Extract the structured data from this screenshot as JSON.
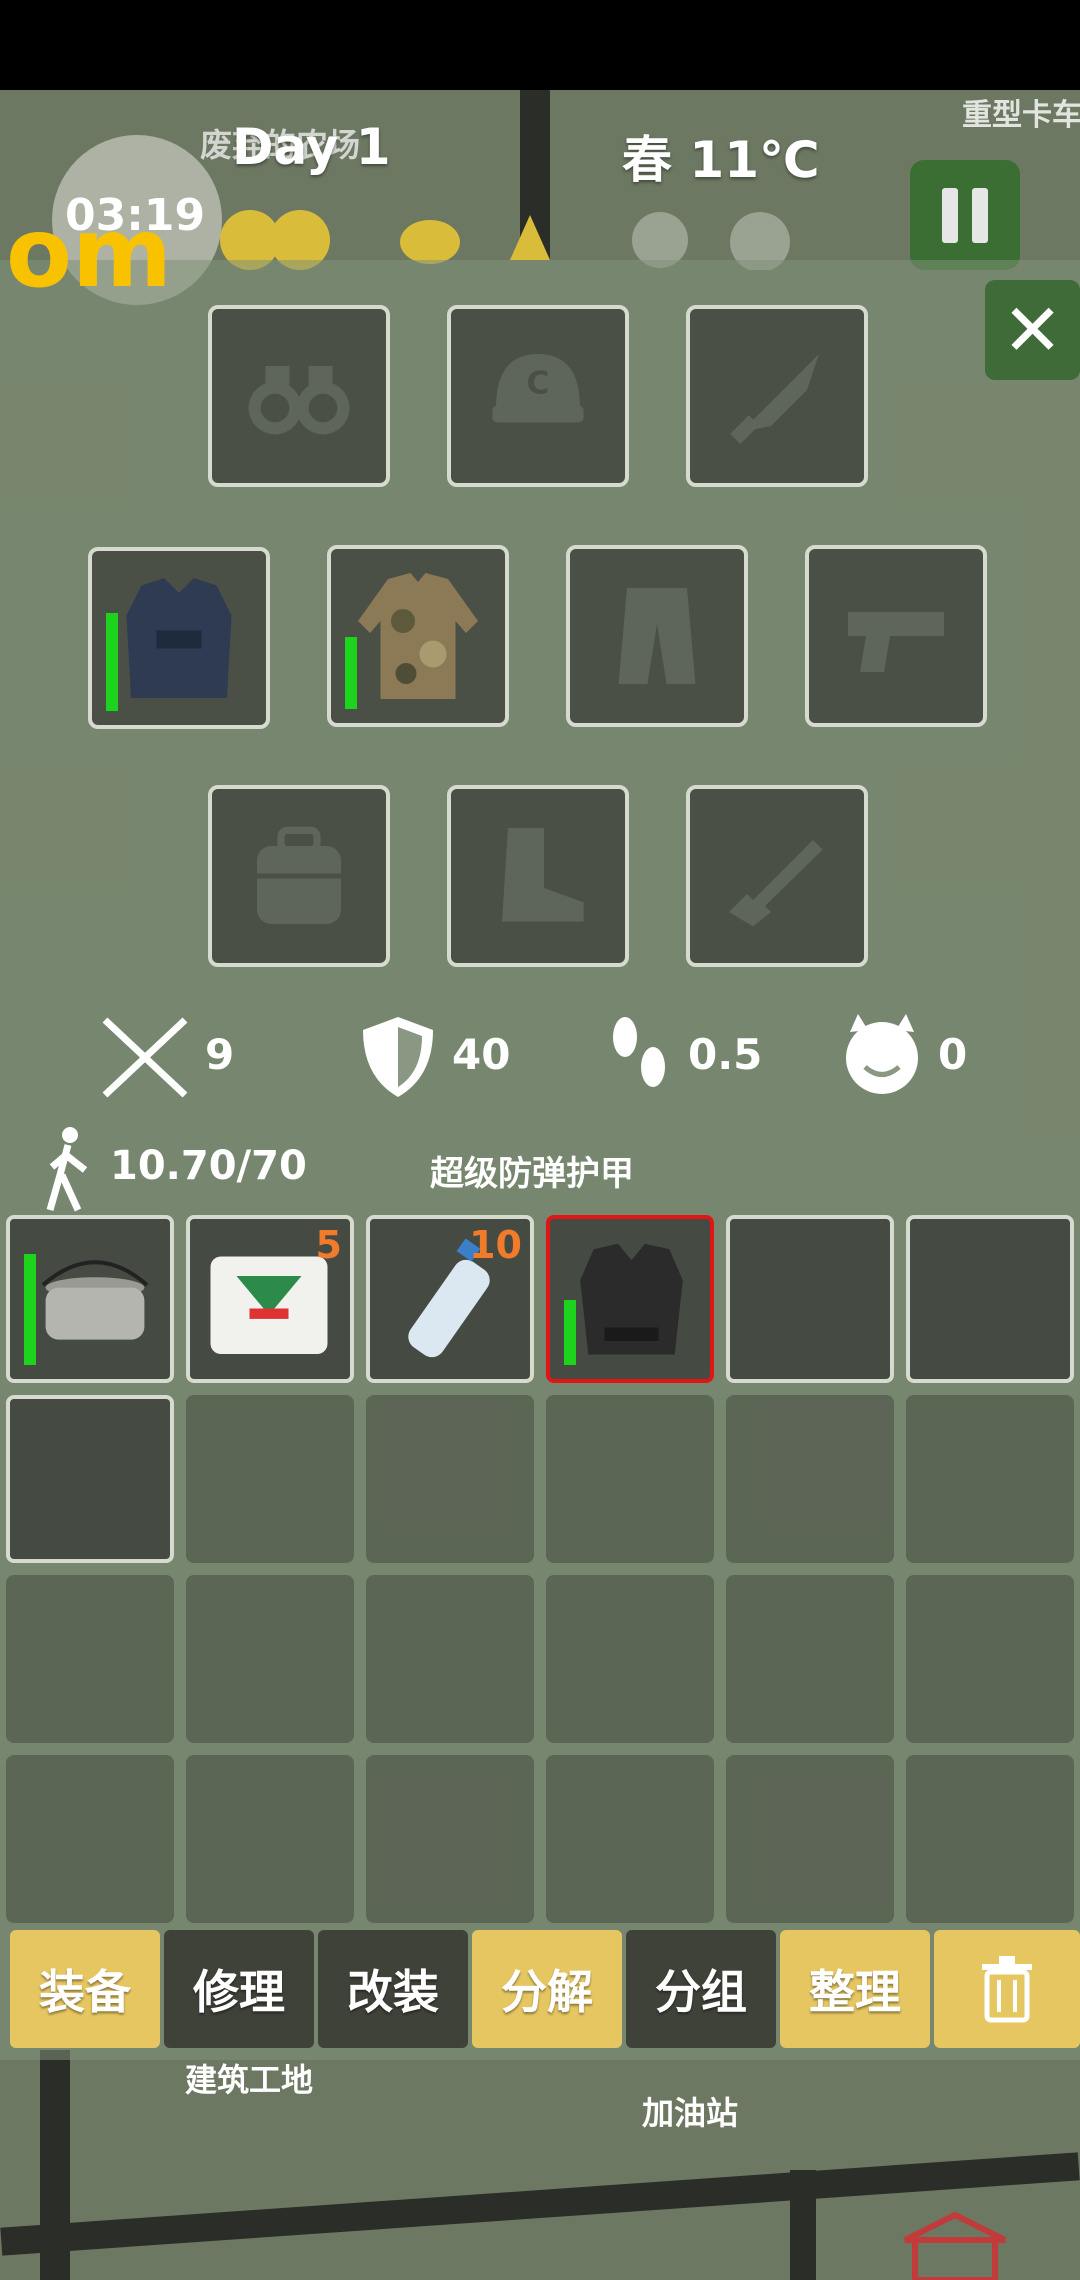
{
  "hud": {
    "day": "Day 1",
    "season_temp": "春  11℃",
    "clock": "03:19",
    "overlay_text": "om",
    "map_top_left": "废弃的农场",
    "map_top_right": "重型卡车"
  },
  "equipment": {
    "slots": [
      {
        "name": "binoculars",
        "icon": "binoculars-icon",
        "empty": true
      },
      {
        "name": "helmet",
        "icon": "helmet-icon",
        "empty": true
      },
      {
        "name": "knife",
        "icon": "knife-icon",
        "empty": true
      },
      {
        "name": "armor-vest",
        "icon": "armor-vest-icon",
        "empty": false,
        "durability": 0.75
      },
      {
        "name": "camo-jacket",
        "icon": "camo-jacket-icon",
        "empty": false,
        "durability": 0.55
      },
      {
        "name": "pants",
        "icon": "pants-icon",
        "empty": true
      },
      {
        "name": "pistol",
        "icon": "pistol-icon",
        "empty": true
      },
      {
        "name": "backpack",
        "icon": "backpack-icon",
        "empty": true
      },
      {
        "name": "boots",
        "icon": "boots-icon",
        "empty": true
      },
      {
        "name": "rifle",
        "icon": "rifle-icon",
        "empty": true
      }
    ]
  },
  "stats": {
    "attack": "9",
    "defense": "40",
    "speed": "0.5",
    "evil": "0",
    "weight": "10.70/70",
    "selected_item_name": "超级防弹护甲"
  },
  "inventory": {
    "items": [
      {
        "name": "cooking-pot",
        "count": "",
        "durability": 0.85
      },
      {
        "name": "compressed-biscuits",
        "count": "5"
      },
      {
        "name": "water-bottle",
        "count": "10"
      },
      {
        "name": "super-armor",
        "count": "",
        "durability": 0.5,
        "selected": true
      }
    ]
  },
  "actions": {
    "equip": "装备",
    "repair": "修理",
    "modify": "改装",
    "disassemble": "分解",
    "group": "分组",
    "sort": "整理"
  },
  "map_labels": {
    "construction_site": "建筑工地",
    "gas_station": "加油站"
  },
  "colors": {
    "accent_gold": "#e6c661",
    "durability_green": "#1dd31d",
    "count_orange": "#f07b2a",
    "selected_red": "#e11515"
  }
}
